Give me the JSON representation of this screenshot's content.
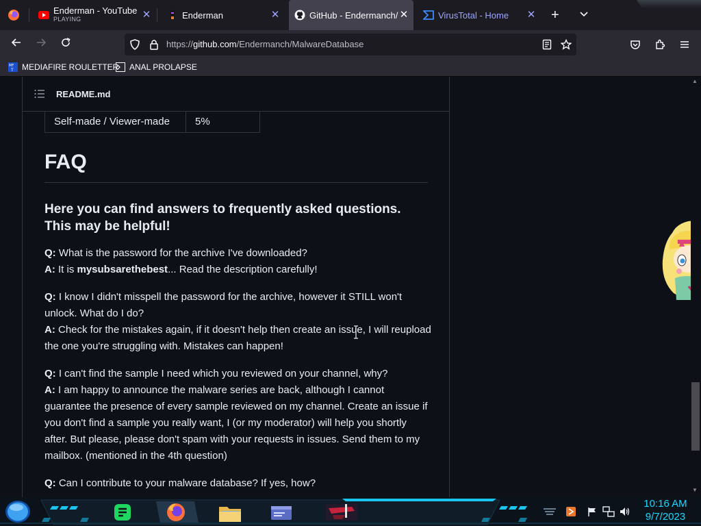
{
  "browser": {
    "tabs": [
      {
        "title": "Enderman - YouTube",
        "subtitle": "PLAYING",
        "icon": "youtube-icon"
      },
      {
        "title": "Enderman",
        "icon": "enderman-icon"
      },
      {
        "title": "GitHub - Endermanch/M",
        "icon": "github-icon"
      },
      {
        "title": "VirusTotal - Home",
        "icon": "virustotal-icon"
      }
    ],
    "url_prefix": "https://",
    "url_host": "github.com",
    "url_path": "/Endermanch/MalwareDatabase",
    "bookmarks": [
      {
        "label": "MEDIAFIRE ROULETTER",
        "icon": "mediafire-icon"
      },
      {
        "label": "ANAL PROLAPSE",
        "icon": "terminal-icon"
      }
    ]
  },
  "readme": {
    "filename": "README.md",
    "table_row": {
      "label": "Self-made / Viewer-made",
      "value": "5%"
    },
    "faq_heading": "FAQ",
    "faq_intro": "Here you can find answers to frequently asked questions. This may be helpful!",
    "qa": [
      {
        "q_label": "Q:",
        "q": " What is the password for the archive I've downloaded?",
        "a_label": "A:",
        "a_pre": " It is ",
        "a_bold": "mysubsarethebest",
        "a_post": "... Read the description carefully!"
      },
      {
        "q_label": "Q:",
        "q": " I know I didn't misspell the password for the archive, however it STILL won't unlock. What do I do?",
        "a_label": "A:",
        "a_pre": " Check for the mistakes again, if it doesn't help then create an issue, I will reupload the one you're struggling with. Mistakes can happen!",
        "a_bold": "",
        "a_post": ""
      },
      {
        "q_label": "Q:",
        "q": " I can't find the sample I need which you reviewed on your channel, why?",
        "a_label": "A:",
        "a_pre": " I am happy to announce the malware series are back, although I cannot guarantee the presence of every sample reviewed on my channel. Create an issue if you don't find a sample you really want, I (or my moderator) will help you shortly after. But please, please don't spam with your requests in issues. Send them to my mailbox. (mentioned in the 4th question)",
        "a_bold": "",
        "a_post": ""
      },
      {
        "q_label": "Q:",
        "q": " Can I contribute to your malware database? If yes, how?",
        "a_label": "",
        "a_pre": "",
        "a_bold": "",
        "a_post": ""
      }
    ]
  },
  "taskbar": {
    "time": "10:16 AM",
    "date": "9/7/2023",
    "apps": [
      "notes-icon",
      "firefox-icon",
      "file-explorer-icon",
      "window-icon",
      "game-icon"
    ]
  },
  "colors": {
    "accent": "#1ec8ff",
    "tab_close": "#9fa4ff",
    "page_bg": "#0d1117",
    "text": "#e6edf3",
    "border": "#30363d"
  }
}
